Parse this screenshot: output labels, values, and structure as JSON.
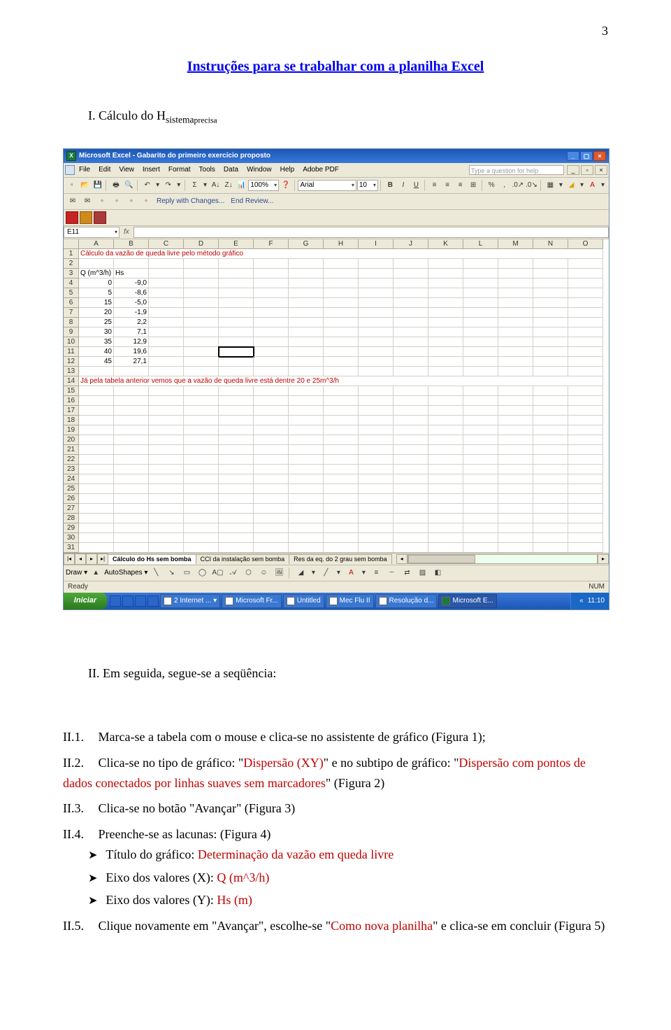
{
  "page_number": "3",
  "doc_title": "Instruções para se trabalhar com a planilha Excel",
  "section1": {
    "label": "I.  Cálculo do H",
    "sub": "sistema",
    "subsub": "precisa"
  },
  "section2_label": "II.  Em seguida, segue-se a seqüência:",
  "items": {
    "ii1_label": "II.1.",
    "ii1_text": "Marca-se a tabela com o mouse e clica-se no assistente de gráfico (Figura 1);",
    "ii2_label": "II.2.",
    "ii2_a": "Clica-se no tipo de gráfico: \"",
    "ii2_red1": "Dispersão (XY)",
    "ii2_b": "\" e no subtipo de gráfico: \"",
    "ii2_red2": "Dispersão com pontos de dados conectados por linhas suaves sem marcadores",
    "ii2_c": "\" (Figura 2)",
    "ii3_label": "II.3.",
    "ii3_text": "Clica-se no botão \"Avançar\" (Figura 3)",
    "ii4_label": "II.4.",
    "ii4_text": "Preenche-se as lacunas: (Figura 4)",
    "ii4_bullets": {
      "a_pre": "Título do gráfico: ",
      "a_red": "Determinação da vazão em queda livre",
      "b_pre": "Eixo dos valores (X): ",
      "b_red": "Q (m^3/h)",
      "c_pre": "Eixo dos valores (Y): ",
      "c_red": "Hs (m)"
    },
    "ii5_label": "II.5.",
    "ii5_a": "Clique novamente em \"Avançar\", escolhe-se \"",
    "ii5_red": "Como nova planilha",
    "ii5_b": "\" e clica-se em concluir (Figura 5)"
  },
  "excel": {
    "title": "Microsoft Excel - Gabarito do primeiro exercício proposto",
    "menus": [
      "File",
      "Edit",
      "View",
      "Insert",
      "Format",
      "Tools",
      "Data",
      "Window",
      "Help",
      "Adobe PDF"
    ],
    "help_placeholder": "Type a question for help",
    "zoom": "100%",
    "font": "Arial",
    "fontsize": "10",
    "reply": "Reply with Changes...",
    "endreview": "End Review...",
    "namebox": "E11",
    "fx": "fx",
    "cols": [
      "A",
      "B",
      "C",
      "D",
      "E",
      "F",
      "G",
      "H",
      "I",
      "J",
      "K",
      "L",
      "M",
      "N",
      "O"
    ],
    "rows": 31,
    "row1_text": "Cálculo da vazão de queda livre pelo método gráfico",
    "row3_a": "Q (m^3/h)",
    "row3_b": "Hs",
    "data": [
      [
        "0",
        "-9,0"
      ],
      [
        "5",
        "-8,6"
      ],
      [
        "15",
        "-5,0"
      ],
      [
        "20",
        "-1,9"
      ],
      [
        "25",
        "2,2"
      ],
      [
        "30",
        "7,1"
      ],
      [
        "35",
        "12,9"
      ],
      [
        "40",
        "19,6"
      ],
      [
        "45",
        "27,1"
      ]
    ],
    "row14_text": "Já pela tabela anterior vemos que a vazão de queda livre está dentre 20 e 25m^3/h",
    "sheets": [
      "Cálculo do Hs sem bomba",
      "CCI da instalação sem bomba",
      "Res da eq. do 2 grau sem bomba"
    ],
    "draw_label": "Draw ▾",
    "autoshapes": "AutoShapes ▾",
    "status": "Ready",
    "numlock": "NUM",
    "start": "Iniciar",
    "tasks": [
      "2 Internet ... ▾",
      "Microsoft Fr...",
      "Untitled",
      "Mec Flu II",
      "Resolução d...",
      "Microsoft E..."
    ],
    "clock": "11:10"
  }
}
